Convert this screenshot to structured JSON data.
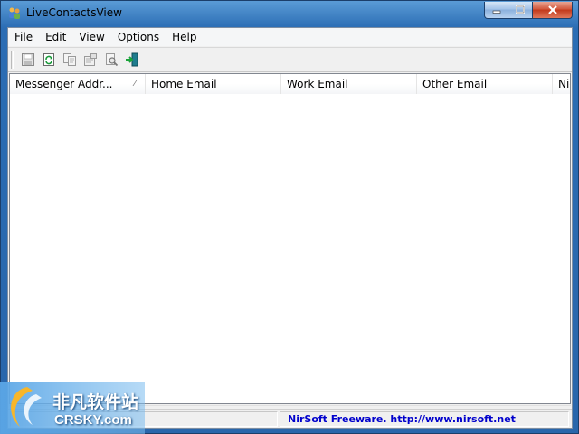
{
  "window": {
    "title": "LiveContactsView"
  },
  "menu": {
    "items": [
      "File",
      "Edit",
      "View",
      "Options",
      "Help"
    ]
  },
  "toolbar": {
    "icons": [
      "save-icon",
      "refresh-icon",
      "copy-icon",
      "properties-icon",
      "find-icon",
      "exit-icon"
    ]
  },
  "list": {
    "columns": [
      "Messenger Addr...",
      "Home Email",
      "Work Email",
      "Other Email",
      "Nic"
    ],
    "rows": []
  },
  "status": {
    "left_text": "",
    "right_text": "NirSoft Freeware.  http://www.nirsoft.net"
  },
  "watermark": {
    "cn": "非凡软件站",
    "en": "CRSKY.com"
  },
  "colors": {
    "frame": "#2b6db4",
    "status_link": "#0000cc"
  }
}
